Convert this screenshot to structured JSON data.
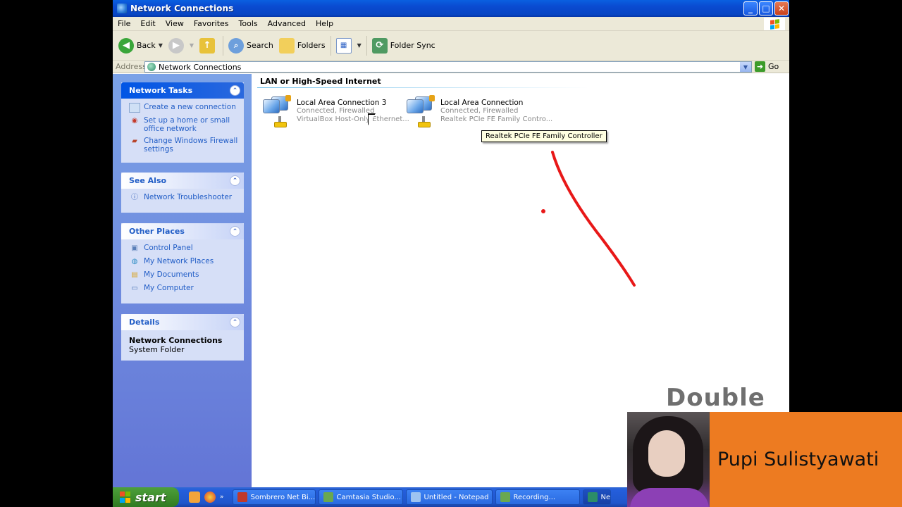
{
  "window": {
    "title": "Network Connections",
    "buttons": {
      "minimize": "_",
      "maximize": "□",
      "close": "✕"
    }
  },
  "menu": [
    "File",
    "Edit",
    "View",
    "Favorites",
    "Tools",
    "Advanced",
    "Help"
  ],
  "toolbar": {
    "back": "Back",
    "search": "Search",
    "folders": "Folders",
    "folder_sync": "Folder Sync"
  },
  "address": {
    "label": "Address",
    "value": "Network Connections",
    "go": "Go"
  },
  "task_pane": {
    "network_tasks": {
      "title": "Network Tasks",
      "items": [
        "Create a new connection",
        "Set up a home or small office network",
        "Change Windows Firewall settings"
      ]
    },
    "see_also": {
      "title": "See Also",
      "items": [
        "Network Troubleshooter"
      ]
    },
    "other_places": {
      "title": "Other Places",
      "items": [
        "Control Panel",
        "My Network Places",
        "My Documents",
        "My Computer"
      ]
    },
    "details": {
      "title": "Details",
      "name": "Network Connections",
      "type": "System Folder"
    }
  },
  "content": {
    "group": "LAN or High-Speed Internet",
    "connections": [
      {
        "name": "Local Area Connection 3",
        "status": "Connected, Firewalled",
        "device": "VirtualBox Host-Only Ethernet..."
      },
      {
        "name": "Local Area Connection",
        "status": "Connected, Firewalled",
        "device": "Realtek PCIe FE Family Contro..."
      }
    ],
    "tooltip": "Realtek PCIe FE Family Controller"
  },
  "annotation": "Double Click",
  "taskbar": {
    "start": "start",
    "tasks": [
      "Sombrero Net Bi...",
      "Camtasia Studio...",
      "Untitled - Notepad",
      "Recording...",
      "Ne"
    ]
  },
  "presenter": {
    "name": "Pupi Sulistyawati"
  },
  "colors": {
    "xp_blue": "#0a4ad0",
    "link": "#215dc6",
    "annotation_red": "#e81818",
    "name_orange": "#ed7b21"
  }
}
